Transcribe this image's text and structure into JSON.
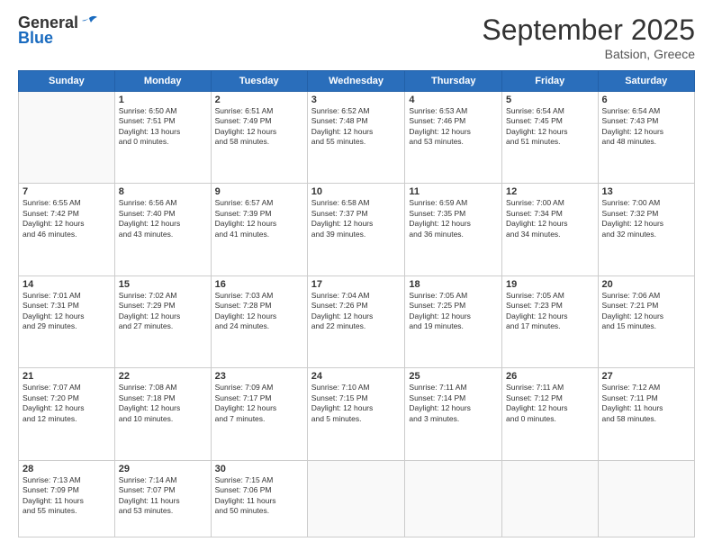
{
  "header": {
    "logo_line1": "General",
    "logo_line2": "Blue",
    "month_title": "September 2025",
    "location": "Batsion, Greece"
  },
  "days_of_week": [
    "Sunday",
    "Monday",
    "Tuesday",
    "Wednesday",
    "Thursday",
    "Friday",
    "Saturday"
  ],
  "weeks": [
    [
      {
        "date": "",
        "sunrise": "",
        "sunset": "",
        "daylight": ""
      },
      {
        "date": "1",
        "sunrise": "Sunrise: 6:50 AM",
        "sunset": "Sunset: 7:51 PM",
        "daylight": "Daylight: 13 hours and 0 minutes."
      },
      {
        "date": "2",
        "sunrise": "Sunrise: 6:51 AM",
        "sunset": "Sunset: 7:49 PM",
        "daylight": "Daylight: 12 hours and 58 minutes."
      },
      {
        "date": "3",
        "sunrise": "Sunrise: 6:52 AM",
        "sunset": "Sunset: 7:48 PM",
        "daylight": "Daylight: 12 hours and 55 minutes."
      },
      {
        "date": "4",
        "sunrise": "Sunrise: 6:53 AM",
        "sunset": "Sunset: 7:46 PM",
        "daylight": "Daylight: 12 hours and 53 minutes."
      },
      {
        "date": "5",
        "sunrise": "Sunrise: 6:54 AM",
        "sunset": "Sunset: 7:45 PM",
        "daylight": "Daylight: 12 hours and 51 minutes."
      },
      {
        "date": "6",
        "sunrise": "Sunrise: 6:54 AM",
        "sunset": "Sunset: 7:43 PM",
        "daylight": "Daylight: 12 hours and 48 minutes."
      }
    ],
    [
      {
        "date": "7",
        "sunrise": "Sunrise: 6:55 AM",
        "sunset": "Sunset: 7:42 PM",
        "daylight": "Daylight: 12 hours and 46 minutes."
      },
      {
        "date": "8",
        "sunrise": "Sunrise: 6:56 AM",
        "sunset": "Sunset: 7:40 PM",
        "daylight": "Daylight: 12 hours and 43 minutes."
      },
      {
        "date": "9",
        "sunrise": "Sunrise: 6:57 AM",
        "sunset": "Sunset: 7:39 PM",
        "daylight": "Daylight: 12 hours and 41 minutes."
      },
      {
        "date": "10",
        "sunrise": "Sunrise: 6:58 AM",
        "sunset": "Sunset: 7:37 PM",
        "daylight": "Daylight: 12 hours and 39 minutes."
      },
      {
        "date": "11",
        "sunrise": "Sunrise: 6:59 AM",
        "sunset": "Sunset: 7:35 PM",
        "daylight": "Daylight: 12 hours and 36 minutes."
      },
      {
        "date": "12",
        "sunrise": "Sunrise: 7:00 AM",
        "sunset": "Sunset: 7:34 PM",
        "daylight": "Daylight: 12 hours and 34 minutes."
      },
      {
        "date": "13",
        "sunrise": "Sunrise: 7:00 AM",
        "sunset": "Sunset: 7:32 PM",
        "daylight": "Daylight: 12 hours and 32 minutes."
      }
    ],
    [
      {
        "date": "14",
        "sunrise": "Sunrise: 7:01 AM",
        "sunset": "Sunset: 7:31 PM",
        "daylight": "Daylight: 12 hours and 29 minutes."
      },
      {
        "date": "15",
        "sunrise": "Sunrise: 7:02 AM",
        "sunset": "Sunset: 7:29 PM",
        "daylight": "Daylight: 12 hours and 27 minutes."
      },
      {
        "date": "16",
        "sunrise": "Sunrise: 7:03 AM",
        "sunset": "Sunset: 7:28 PM",
        "daylight": "Daylight: 12 hours and 24 minutes."
      },
      {
        "date": "17",
        "sunrise": "Sunrise: 7:04 AM",
        "sunset": "Sunset: 7:26 PM",
        "daylight": "Daylight: 12 hours and 22 minutes."
      },
      {
        "date": "18",
        "sunrise": "Sunrise: 7:05 AM",
        "sunset": "Sunset: 7:25 PM",
        "daylight": "Daylight: 12 hours and 19 minutes."
      },
      {
        "date": "19",
        "sunrise": "Sunrise: 7:05 AM",
        "sunset": "Sunset: 7:23 PM",
        "daylight": "Daylight: 12 hours and 17 minutes."
      },
      {
        "date": "20",
        "sunrise": "Sunrise: 7:06 AM",
        "sunset": "Sunset: 7:21 PM",
        "daylight": "Daylight: 12 hours and 15 minutes."
      }
    ],
    [
      {
        "date": "21",
        "sunrise": "Sunrise: 7:07 AM",
        "sunset": "Sunset: 7:20 PM",
        "daylight": "Daylight: 12 hours and 12 minutes."
      },
      {
        "date": "22",
        "sunrise": "Sunrise: 7:08 AM",
        "sunset": "Sunset: 7:18 PM",
        "daylight": "Daylight: 12 hours and 10 minutes."
      },
      {
        "date": "23",
        "sunrise": "Sunrise: 7:09 AM",
        "sunset": "Sunset: 7:17 PM",
        "daylight": "Daylight: 12 hours and 7 minutes."
      },
      {
        "date": "24",
        "sunrise": "Sunrise: 7:10 AM",
        "sunset": "Sunset: 7:15 PM",
        "daylight": "Daylight: 12 hours and 5 minutes."
      },
      {
        "date": "25",
        "sunrise": "Sunrise: 7:11 AM",
        "sunset": "Sunset: 7:14 PM",
        "daylight": "Daylight: 12 hours and 3 minutes."
      },
      {
        "date": "26",
        "sunrise": "Sunrise: 7:11 AM",
        "sunset": "Sunset: 7:12 PM",
        "daylight": "Daylight: 12 hours and 0 minutes."
      },
      {
        "date": "27",
        "sunrise": "Sunrise: 7:12 AM",
        "sunset": "Sunset: 7:11 PM",
        "daylight": "Daylight: 11 hours and 58 minutes."
      }
    ],
    [
      {
        "date": "28",
        "sunrise": "Sunrise: 7:13 AM",
        "sunset": "Sunset: 7:09 PM",
        "daylight": "Daylight: 11 hours and 55 minutes."
      },
      {
        "date": "29",
        "sunrise": "Sunrise: 7:14 AM",
        "sunset": "Sunset: 7:07 PM",
        "daylight": "Daylight: 11 hours and 53 minutes."
      },
      {
        "date": "30",
        "sunrise": "Sunrise: 7:15 AM",
        "sunset": "Sunset: 7:06 PM",
        "daylight": "Daylight: 11 hours and 50 minutes."
      },
      {
        "date": "",
        "sunrise": "",
        "sunset": "",
        "daylight": ""
      },
      {
        "date": "",
        "sunrise": "",
        "sunset": "",
        "daylight": ""
      },
      {
        "date": "",
        "sunrise": "",
        "sunset": "",
        "daylight": ""
      },
      {
        "date": "",
        "sunrise": "",
        "sunset": "",
        "daylight": ""
      }
    ]
  ]
}
